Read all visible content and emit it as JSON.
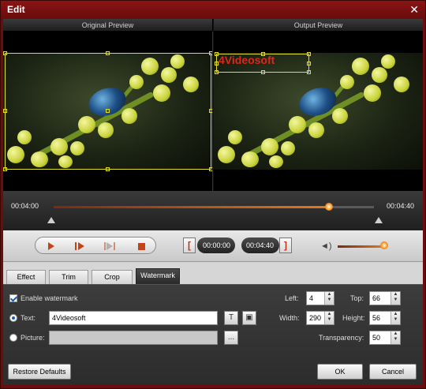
{
  "window": {
    "title": "Edit",
    "close_icon": "close-icon"
  },
  "preview": {
    "original_label": "Original Preview",
    "output_label": "Output Preview",
    "watermark_text": "4Videosoft"
  },
  "timeline": {
    "start_time": "00:04:00",
    "end_time": "00:04:40",
    "progress": 0.86
  },
  "controls": {
    "play_icon": "play-icon",
    "next_frame_icon": "step-forward-icon",
    "end_frame_icon": "step-end-icon",
    "stop_icon": "stop-icon",
    "start_time": "00:00:00",
    "end_time": "00:04:40",
    "set_start_symbol": "[",
    "set_end_symbol": "]",
    "volume_icon": "volume-icon",
    "volume": 1.0
  },
  "tabs": [
    {
      "label": "Effect",
      "active": false
    },
    {
      "label": "Trim",
      "active": false
    },
    {
      "label": "Crop",
      "active": false
    },
    {
      "label": "Watermark",
      "active": true
    }
  ],
  "watermark": {
    "enable_label": "Enable watermark",
    "enabled": true,
    "text_label": "Text:",
    "text_value": "4Videosoft",
    "text_selected": true,
    "picture_label": "Picture:",
    "picture_value": "",
    "browse_label": "...",
    "font_button": "T",
    "color_button": "▣",
    "left_label": "Left:",
    "left_value": "4",
    "top_label": "Top:",
    "top_value": "66",
    "width_label": "Width:",
    "width_value": "290",
    "height_label": "Height:",
    "height_value": "56",
    "transparency_label": "Transparency:",
    "transparency_value": "50"
  },
  "footer": {
    "restore_label": "Restore Defaults",
    "ok_label": "OK",
    "cancel_label": "Cancel"
  },
  "colors": {
    "accent": "#c2451a",
    "titlebar": "#6b0d0d",
    "watermark": "#d9291c",
    "selection": "#e1df2a"
  }
}
